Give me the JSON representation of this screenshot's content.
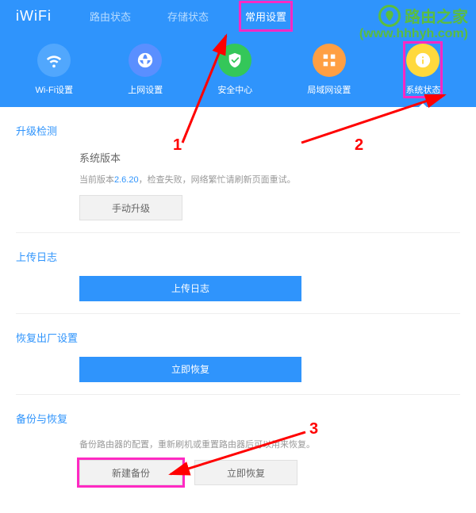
{
  "logo": "iWiFi",
  "topTabs": [
    "路由状态",
    "存储状态",
    "常用设置"
  ],
  "iconNav": [
    {
      "label": "Wi-Fi设置",
      "color": "#51a7fd"
    },
    {
      "label": "上网设置",
      "color": "#5a8fff"
    },
    {
      "label": "安全中心",
      "color": "#34c759"
    },
    {
      "label": "局域网设置",
      "color": "#ff9f43"
    },
    {
      "label": "系统状态",
      "color": "#ffd93d"
    }
  ],
  "sections": {
    "upgrade": {
      "title": "升级检测",
      "subtitle": "系统版本",
      "descPrefix": "当前版本",
      "version": "2.6.20",
      "descSuffix": "，检查失败，网络繁忙请刷新页面重试。",
      "btn": "手动升级"
    },
    "log": {
      "title": "上传日志",
      "btn": "上传日志"
    },
    "restore": {
      "title": "恢复出厂设置",
      "btn": "立即恢复"
    },
    "backup": {
      "title": "备份与恢复",
      "desc": "备份路由器的配置，重新刷机或重置路由器后可以用来恢复。",
      "btn1": "新建备份",
      "btn2": "立即恢复"
    }
  },
  "watermark": {
    "brand": "路由之家",
    "url": "(www.hhhyh.com)"
  },
  "annotations": {
    "num1": "1",
    "num2": "2",
    "num3": "3"
  }
}
